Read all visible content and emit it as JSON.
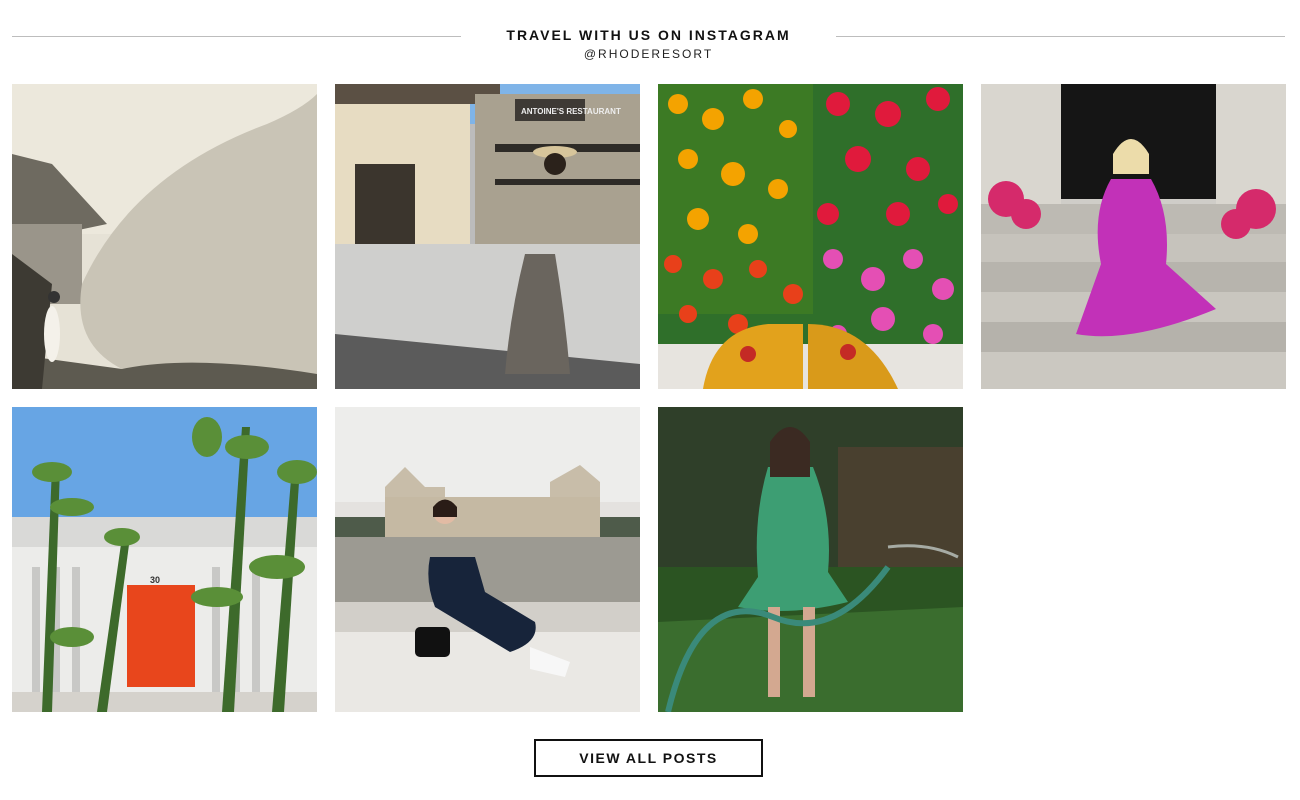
{
  "header": {
    "title": "TRAVEL WITH US ON INSTAGRAM",
    "handle": "@RHODERESORT"
  },
  "posts": [
    {
      "subject": "woman-by-concrete-sculpture"
    },
    {
      "subject": "woman-in-new-orleans-street",
      "sign_text": "ANTOINE'S RESTAURANT"
    },
    {
      "subject": "flower-bed-feet"
    },
    {
      "subject": "woman-on-stoop-pink-dress"
    },
    {
      "subject": "orange-door-palms",
      "door_number": "30"
    },
    {
      "subject": "woman-by-fountain-paris"
    },
    {
      "subject": "woman-with-garden-hose"
    }
  ],
  "cta": {
    "label": "VIEW ALL POSTS"
  }
}
